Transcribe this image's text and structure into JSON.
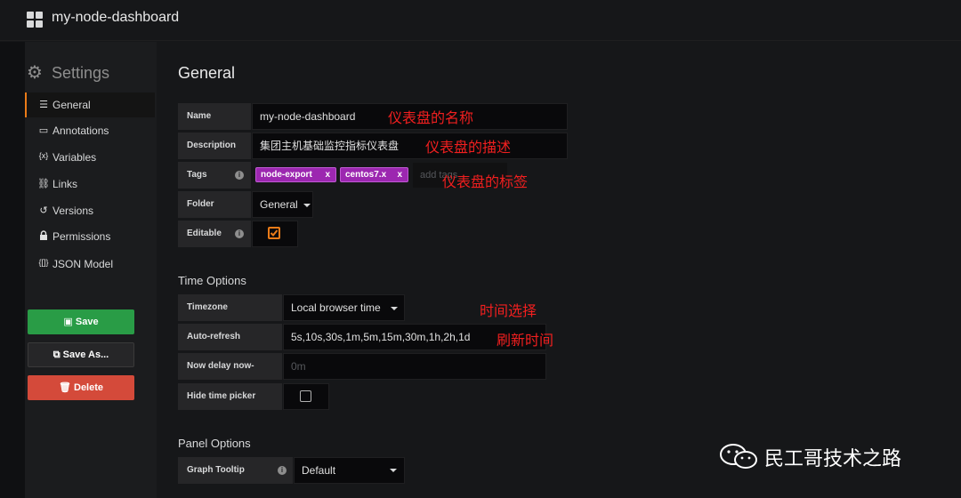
{
  "topbar": {
    "title": "my-node-dashboard",
    "icon": "grid-icon"
  },
  "sidebar": {
    "heading": "Settings",
    "items": [
      {
        "icon": "sliders-icon",
        "glyph": "☰",
        "label": "General",
        "active": true
      },
      {
        "icon": "comment-icon",
        "glyph": "▭",
        "label": "Annotations"
      },
      {
        "icon": "variable-icon",
        "glyph": "{x}",
        "label": "Variables"
      },
      {
        "icon": "link-icon",
        "glyph": "⛓",
        "label": "Links"
      },
      {
        "icon": "history-icon",
        "glyph": "↺",
        "label": "Versions"
      },
      {
        "icon": "lock-icon",
        "glyph": "🔒",
        "label": "Permissions"
      },
      {
        "icon": "json-icon",
        "glyph": "{[]}",
        "label": "JSON Model"
      }
    ],
    "buttons": {
      "save": "Save",
      "save_as": "Save As...",
      "delete": "Delete"
    }
  },
  "general": {
    "heading": "General",
    "name_label": "Name",
    "name_value": "my-node-dashboard",
    "description_label": "Description",
    "description_value": "集团主机基础监控指标仪表盘",
    "tags_label": "Tags",
    "tags": [
      "node-export",
      "centos7.x"
    ],
    "tag_remove": "x",
    "tags_placeholder": "add tags",
    "folder_label": "Folder",
    "folder_value": "General",
    "editable_label": "Editable",
    "editable_checked": true
  },
  "time_options": {
    "heading": "Time Options",
    "timezone_label": "Timezone",
    "timezone_value": "Local browser time",
    "autorefresh_label": "Auto-refresh",
    "autorefresh_value": "5s,10s,30s,1m,5m,15m,30m,1h,2h,1d",
    "nowdelay_label": "Now delay now-",
    "nowdelay_placeholder": "0m",
    "hidetime_label": "Hide time picker",
    "hidetime_checked": false
  },
  "panel_options": {
    "heading": "Panel Options",
    "tooltip_label": "Graph Tooltip",
    "tooltip_value": "Default"
  },
  "annotations": {
    "name_note": "仪表盘的名称",
    "desc_note": "仪表盘的描述",
    "tags_note": "仪表盘的标签",
    "timezone_note": "时间选择",
    "refresh_note": "刷新时间"
  },
  "watermark": {
    "text": "民工哥技术之路"
  },
  "colors": {
    "accent_orange": "#eb7b18",
    "save_green": "#299c46",
    "delete_red": "#d44a3a",
    "tag_purple": "#9c27b0",
    "note_red": "#f11f1f"
  }
}
